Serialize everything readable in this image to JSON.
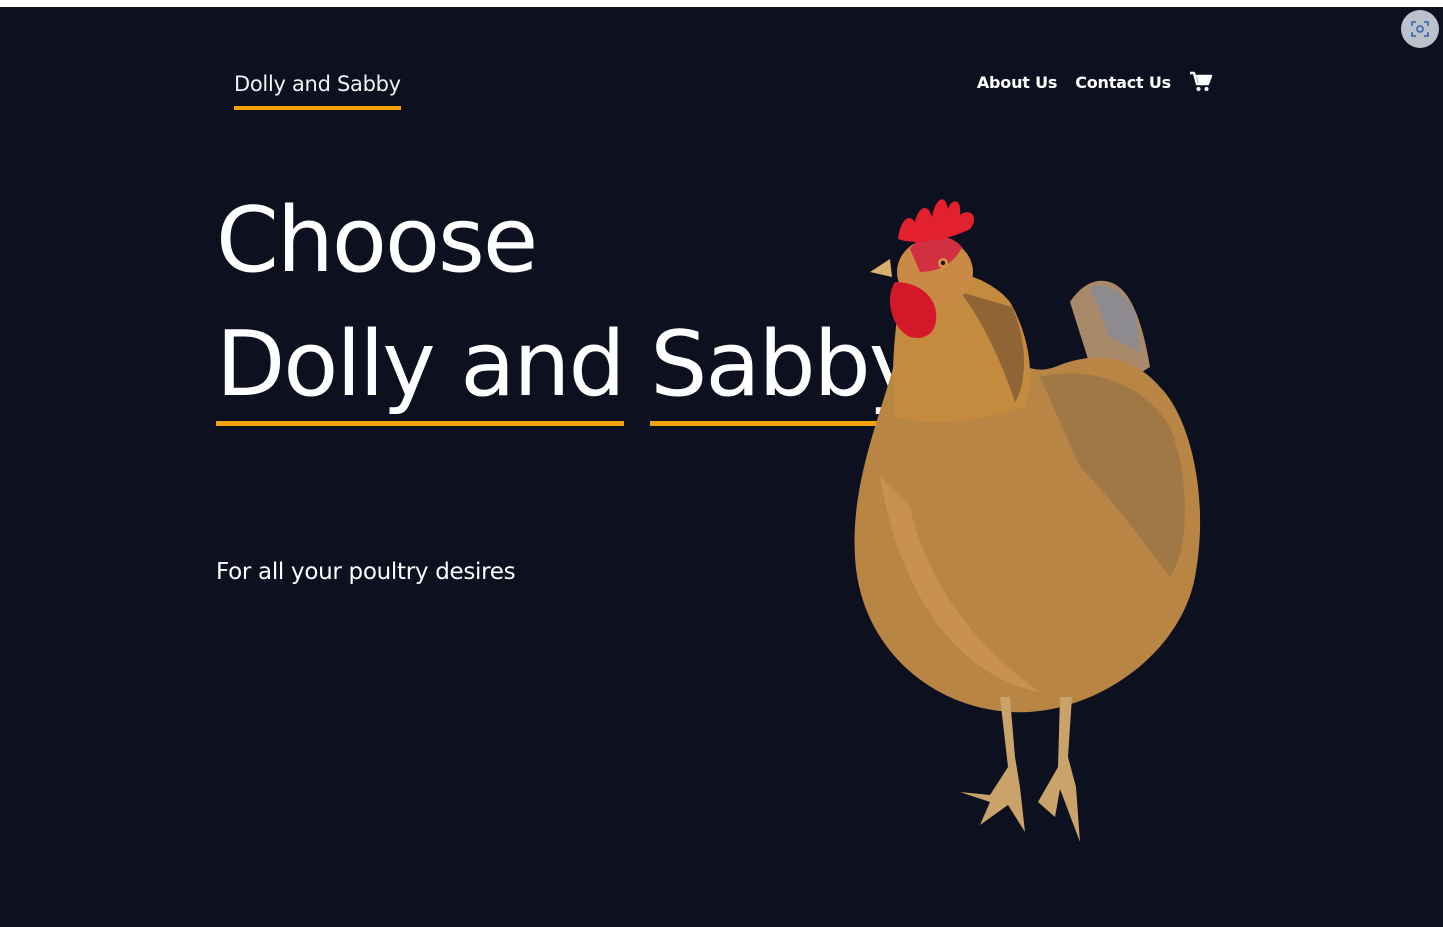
{
  "header": {
    "brand": "Dolly and Sabby",
    "nav": {
      "about": "About Us",
      "contact": "Contact Us"
    },
    "cart_icon": "shopping-cart-icon"
  },
  "hero": {
    "line1": "Choose",
    "line2": "Dolly and",
    "line3": "Sabby",
    "tagline": "For all your poultry desires"
  },
  "colors": {
    "background": "#0c101f",
    "accent": "#f5a20a",
    "text": "#ffffff"
  },
  "image": {
    "subject": "hen-image"
  },
  "overlay": {
    "icon": "screenshot-lens-icon"
  }
}
